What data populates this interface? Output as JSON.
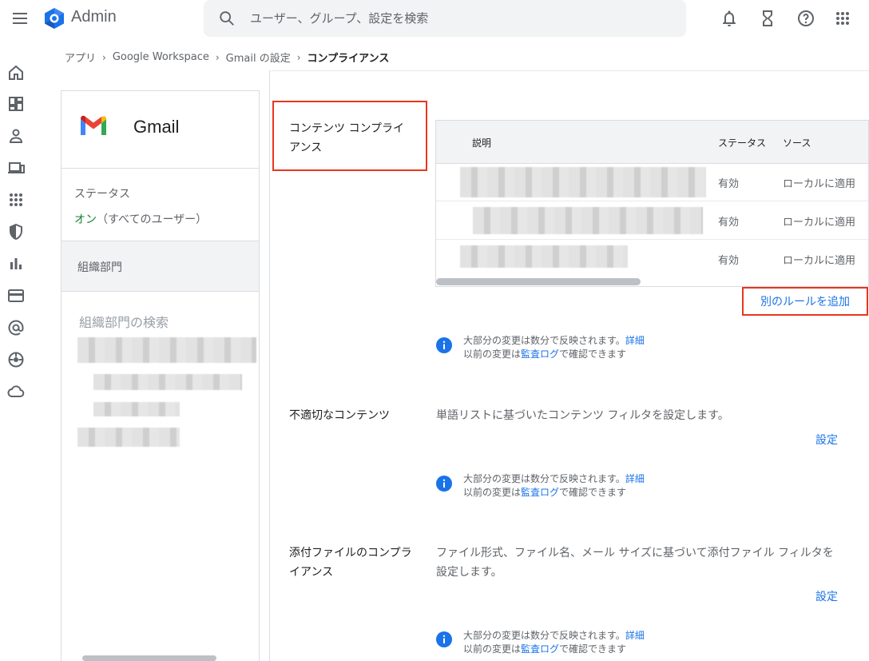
{
  "header": {
    "brand": "Admin",
    "search_placeholder": "ユーザー、グループ、設定を検索"
  },
  "breadcrumb": [
    "アプリ",
    "Google Workspace",
    "Gmail の設定",
    "コンプライアンス"
  ],
  "side_panel": {
    "app_title": "Gmail",
    "status_label": "ステータス",
    "status_on": "オン",
    "status_scope": "（すべてのユーザー）",
    "org_units_label": "組織部門",
    "org_search_placeholder": "組織部門の検索"
  },
  "sections": {
    "content_compliance": {
      "label_line1": "コンテンツ コンプライ",
      "label_line2": "アンス",
      "table": {
        "headers": [
          "説明",
          "ステータス",
          "ソース"
        ],
        "rows": [
          {
            "status": "有効",
            "source": "ローカルに適用"
          },
          {
            "status": "有効",
            "source": "ローカルに適用"
          },
          {
            "status": "有効",
            "source": "ローカルに適用"
          }
        ]
      },
      "add_rule": "別のルールを追加"
    },
    "objectionable": {
      "label": "不適切なコンテンツ",
      "description": "単語リストに基づいたコンテンツ フィルタを設定します。",
      "setting": "設定"
    },
    "attachment": {
      "label_line1": "添付ファイルのコンプラ",
      "label_line2": "イアンス",
      "description_line1": "ファイル形式、ファイル名、メール サイズに基づいて添付ファイル フィルタを",
      "description_line2": "設定します。",
      "setting": "設定"
    }
  },
  "info_note": {
    "line1_prefix": "大部分の変更は数分で反映されます。",
    "line1_link": "詳細",
    "line2_prefix": "以前の変更は",
    "line2_link": "監査ログ",
    "line2_suffix": "で確認できます"
  },
  "colors": {
    "accent": "#1a73e8",
    "highlight": "#e8361f",
    "on_status": "#188038"
  }
}
